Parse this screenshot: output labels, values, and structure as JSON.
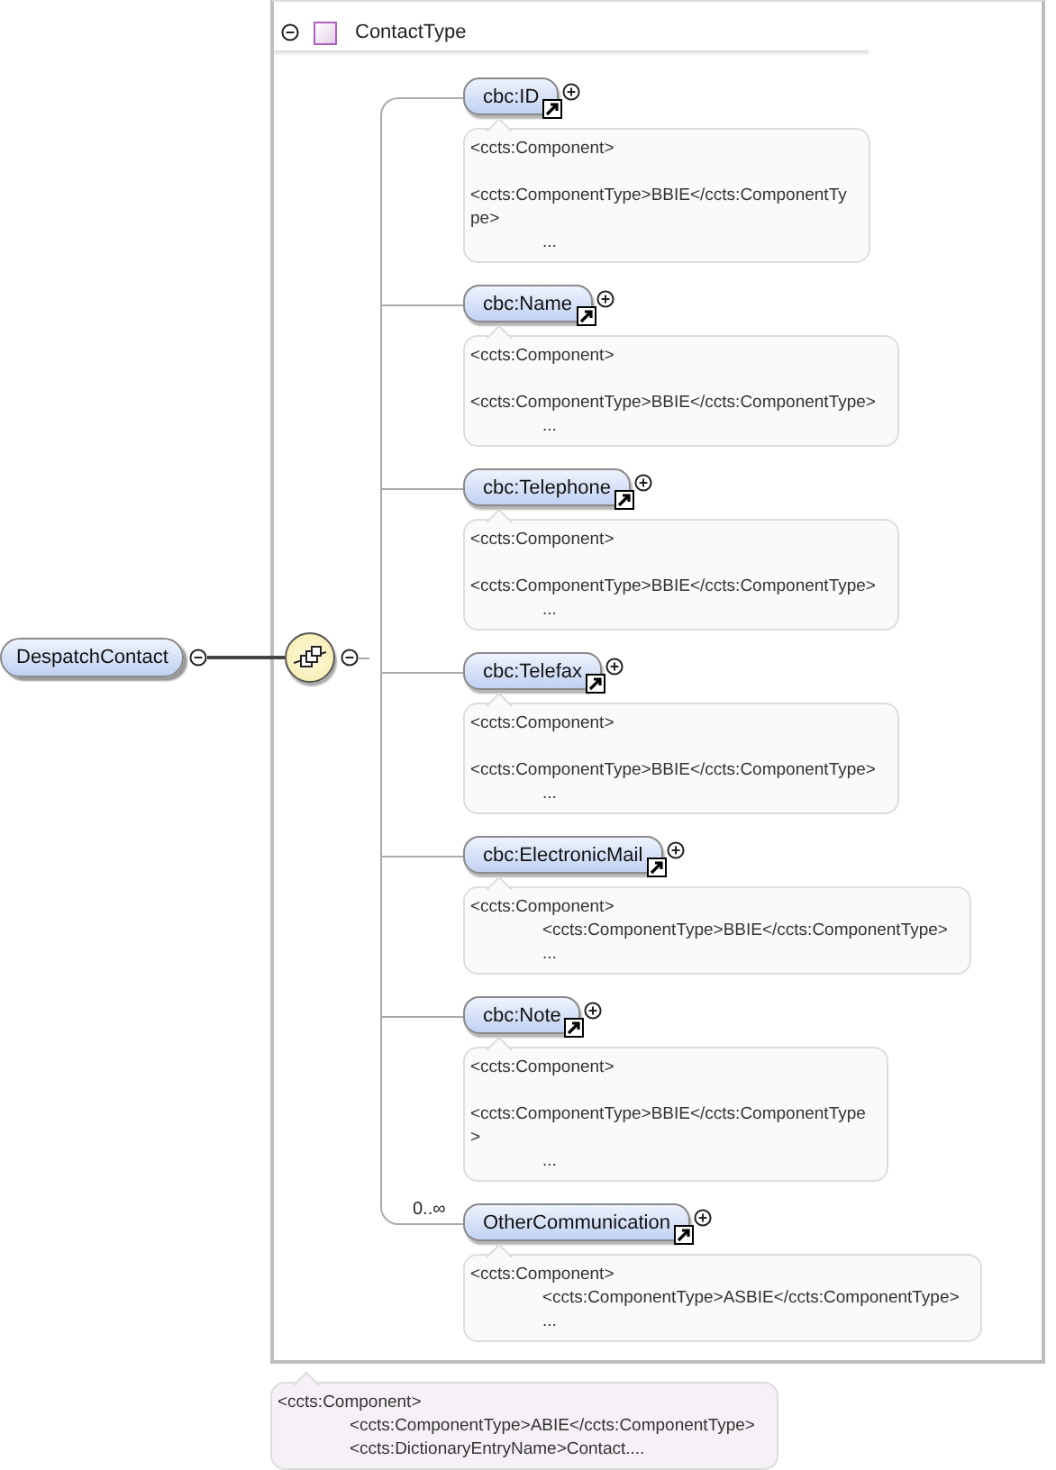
{
  "element": {
    "name": "DespatchContact",
    "expanded": true
  },
  "compositor": {
    "kind": "sequence",
    "expanded": true
  },
  "type_box": {
    "title": "ContactType",
    "expanded": true,
    "children": [
      {
        "name": "cbc:ID",
        "reference": true,
        "expanded": false,
        "annotation": [
          {
            "text": "<ccts:Component>",
            "indent": false,
            "gap": false
          },
          {
            "text": "<ccts:ComponentType>BBIE</ccts:ComponentTy",
            "indent": false,
            "gap": true
          },
          {
            "text": "pe>",
            "indent": false,
            "gap": false
          },
          {
            "text": "...",
            "indent": true,
            "gap": false
          }
        ]
      },
      {
        "name": "cbc:Name",
        "reference": true,
        "expanded": false,
        "annotation": [
          {
            "text": "<ccts:Component>",
            "indent": false,
            "gap": false
          },
          {
            "text": "<ccts:ComponentType>BBIE</ccts:ComponentType>",
            "indent": false,
            "gap": true
          },
          {
            "text": "...",
            "indent": true,
            "gap": false
          }
        ]
      },
      {
        "name": "cbc:Telephone",
        "reference": true,
        "expanded": false,
        "annotation": [
          {
            "text": "<ccts:Component>",
            "indent": false,
            "gap": false
          },
          {
            "text": "<ccts:ComponentType>BBIE</ccts:ComponentType>",
            "indent": false,
            "gap": true
          },
          {
            "text": "...",
            "indent": true,
            "gap": false
          }
        ]
      },
      {
        "name": "cbc:Telefax",
        "reference": true,
        "expanded": false,
        "annotation": [
          {
            "text": "<ccts:Component>",
            "indent": false,
            "gap": false
          },
          {
            "text": "<ccts:ComponentType>BBIE</ccts:ComponentType>",
            "indent": false,
            "gap": true
          },
          {
            "text": "...",
            "indent": true,
            "gap": false
          }
        ]
      },
      {
        "name": "cbc:ElectronicMail",
        "reference": true,
        "expanded": false,
        "annotation": [
          {
            "text": "<ccts:Component>",
            "indent": false,
            "gap": false
          },
          {
            "text": "<ccts:ComponentType>BBIE</ccts:ComponentType>",
            "indent": true,
            "gap": false
          },
          {
            "text": "...",
            "indent": true,
            "gap": false
          }
        ]
      },
      {
        "name": "cbc:Note",
        "reference": true,
        "expanded": false,
        "annotation": [
          {
            "text": "<ccts:Component>",
            "indent": false,
            "gap": false
          },
          {
            "text": "<ccts:ComponentType>BBIE</ccts:ComponentType",
            "indent": false,
            "gap": true
          },
          {
            "text": ">",
            "indent": false,
            "gap": false
          },
          {
            "text": "...",
            "indent": true,
            "gap": false
          }
        ]
      },
      {
        "name": "OtherCommunication",
        "occurs": "0..∞",
        "reference": true,
        "expanded": false,
        "annotation": [
          {
            "text": "<ccts:Component>",
            "indent": false,
            "gap": false
          },
          {
            "text": "<ccts:ComponentType>ASBIE</ccts:ComponentType>",
            "indent": true,
            "gap": false
          },
          {
            "text": "...",
            "indent": true,
            "gap": false
          }
        ]
      }
    ]
  },
  "type_annotation": [
    {
      "text": "<ccts:Component>",
      "indent": false,
      "gap": false
    },
    {
      "text": "<ccts:ComponentType>ABIE</ccts:ComponentType>",
      "indent": true,
      "gap": false
    },
    {
      "text": "<ccts:DictionaryEntryName>Contact....",
      "indent": true,
      "gap": false
    }
  ]
}
